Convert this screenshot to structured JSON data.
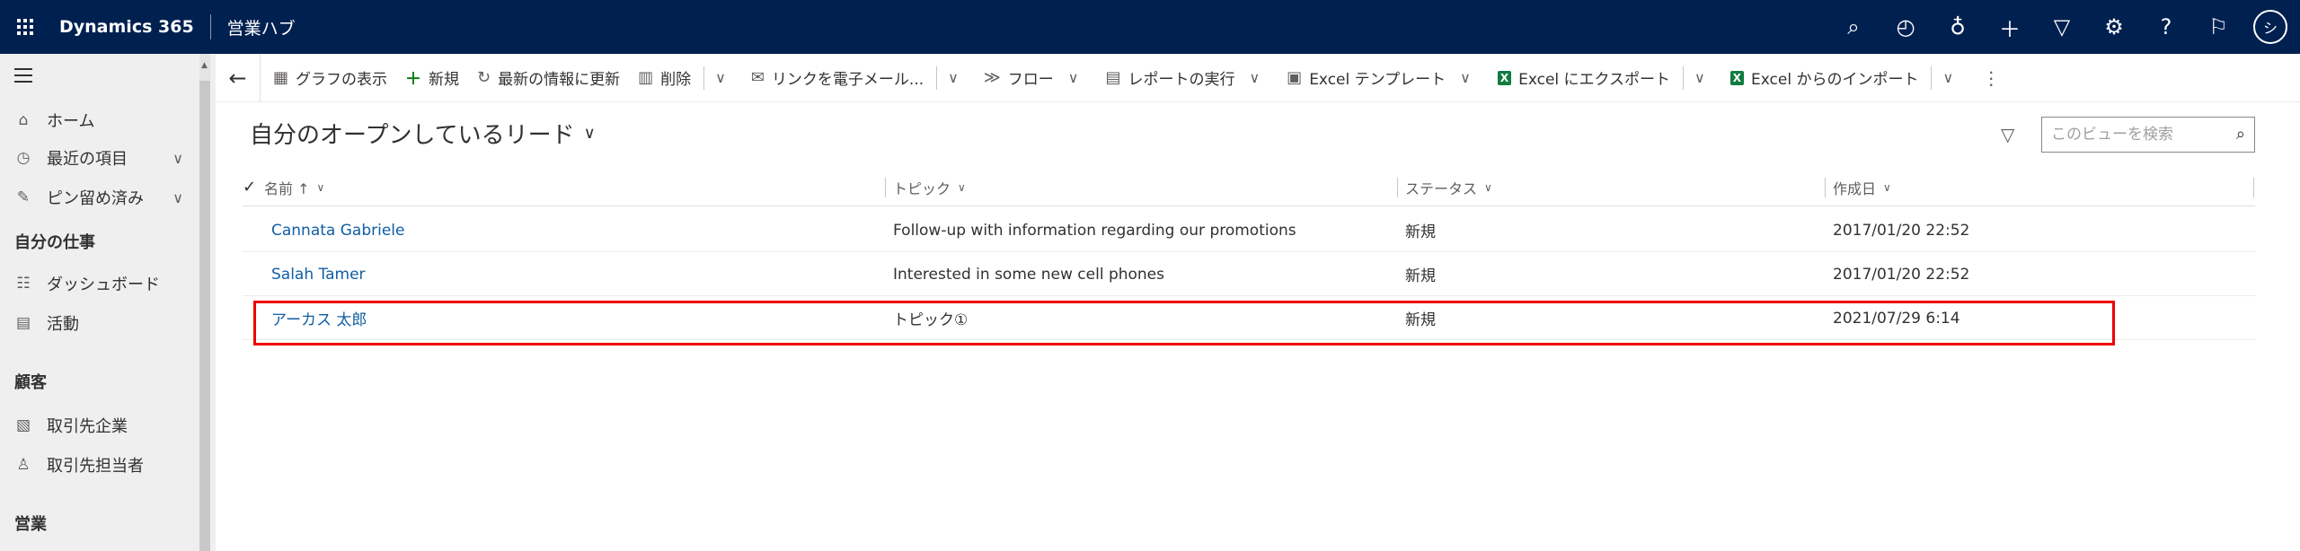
{
  "topbar": {
    "app_title": "Dynamics 365",
    "app_subtitle": "営業ハブ",
    "avatar_initial": "シ",
    "icons": [
      "search-icon",
      "lightbulb-goal-icon",
      "lightbulb-icon",
      "plus-icon",
      "filter-icon",
      "gear-icon",
      "help-icon",
      "feedback-icon"
    ]
  },
  "commandbar": {
    "items": [
      {
        "label": "グラフの表示",
        "icon": "chart-icon"
      },
      {
        "label": "新規",
        "icon": "plus-icon"
      },
      {
        "label": "最新の情報に更新",
        "icon": "refresh-icon"
      },
      {
        "label": "削除",
        "icon": "trash-icon"
      },
      {
        "label": "リンクを電子メール...",
        "icon": "email-link-icon"
      },
      {
        "label": "フロー",
        "icon": "flow-icon"
      },
      {
        "label": "レポートの実行",
        "icon": "report-icon"
      },
      {
        "label": "Excel テンプレート",
        "icon": "excel-template-icon"
      },
      {
        "label": "Excel にエクスポート",
        "icon": "excel-icon"
      },
      {
        "label": "Excel からのインポート",
        "icon": "excel-icon"
      }
    ]
  },
  "sidebar": {
    "items": [
      {
        "label": "ホーム",
        "icon": "home-icon"
      },
      {
        "label": "最近の項目",
        "icon": "clock-icon"
      },
      {
        "label": "ピン留め済み",
        "icon": "pin-icon"
      }
    ],
    "sections": [
      {
        "title": "自分の仕事",
        "items": [
          {
            "label": "ダッシュボード",
            "icon": "dashboard-icon"
          },
          {
            "label": "活動",
            "icon": "activity-icon"
          }
        ]
      },
      {
        "title": "顧客",
        "items": [
          {
            "label": "取引先企業",
            "icon": "building-icon"
          },
          {
            "label": "取引先担当者",
            "icon": "person-icon"
          }
        ]
      },
      {
        "title": "営業",
        "items": []
      }
    ]
  },
  "view": {
    "title": "自分のオープンしているリード",
    "search_placeholder": "このビューを検索"
  },
  "grid": {
    "columns": [
      "名前 ↑",
      "トピック",
      "ステータス",
      "作成日"
    ],
    "rows": [
      {
        "name": "Cannata Gabriele",
        "topic": "Follow-up with information regarding our promotions",
        "status": "新規",
        "created": "2017/01/20 22:52"
      },
      {
        "name": "Salah Tamer",
        "topic": "Interested in some new cell phones",
        "status": "新規",
        "created": "2017/01/20 22:52"
      },
      {
        "name": "アーカス 太郎",
        "topic": "トピック①",
        "status": "新規",
        "created": "2021/07/29 6:14"
      }
    ]
  },
  "colors": {
    "topbar": "#002050",
    "link": "#115ea3",
    "highlight": "#ee0000"
  }
}
